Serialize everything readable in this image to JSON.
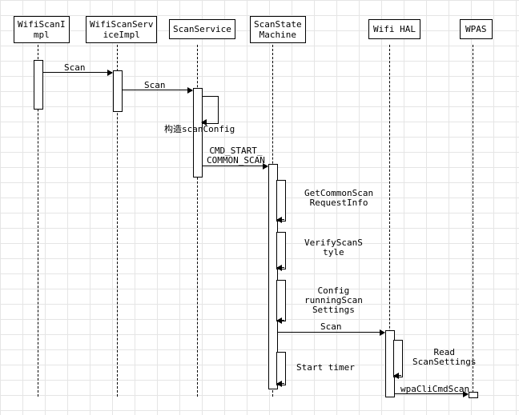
{
  "participants": {
    "p1": "WifiScanI\nmpl",
    "p2": "WifiScanServ\niceImpl",
    "p3": "ScanService",
    "p4": "ScanState\nMachine",
    "p5": "Wifi HAL",
    "p6": "WPAS"
  },
  "messages": {
    "m1": "Scan",
    "m2": "Scan",
    "m3": "构造scanConfig",
    "m4": "CMD_START_\nCOMMON_SCAN",
    "m5": "GetCommonScan\nRequestInfo",
    "m6": "VerifyScanS\ntyle",
    "m7": "Config\nrunningScan\nSettings",
    "m8": "Scan",
    "m9": "Read\nScanSettings",
    "m10": "Start timer",
    "m11": "wpaCliCmdScan"
  }
}
